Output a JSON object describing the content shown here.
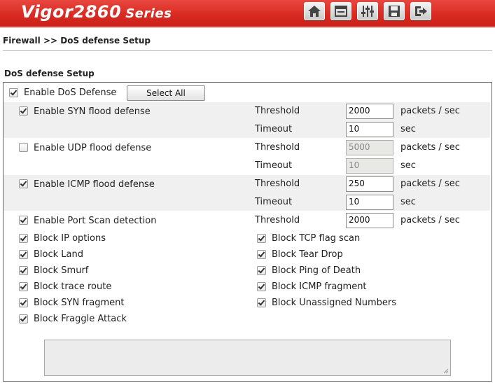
{
  "header": {
    "brand_name": "Vigor2860",
    "brand_series": "Series",
    "icons": [
      "home-icon",
      "quick-start-icon",
      "online-status-icon",
      "save-config-icon",
      "logout-icon"
    ],
    "accent": "#d92b22"
  },
  "breadcrumb": "Firewall >> DoS defense Setup",
  "section_title": "DoS defense Setup",
  "enable_dos": {
    "label": "Enable DoS Defense",
    "checked": true
  },
  "select_all_label": "Select All",
  "flood": [
    {
      "label": "Enable SYN flood defense",
      "checked": true,
      "threshold_label": "Threshold",
      "threshold": "2000",
      "threshold_unit": "packets / sec",
      "timeout_label": "Timeout",
      "timeout": "10",
      "timeout_unit": "sec",
      "disabled": false
    },
    {
      "label": "Enable UDP flood defense",
      "checked": false,
      "threshold_label": "Threshold",
      "threshold": "5000",
      "threshold_unit": "packets / sec",
      "timeout_label": "Timeout",
      "timeout": "10",
      "timeout_unit": "sec",
      "disabled": true
    },
    {
      "label": "Enable ICMP flood defense",
      "checked": true,
      "threshold_label": "Threshold",
      "threshold": "250",
      "threshold_unit": "packets / sec",
      "timeout_label": "Timeout",
      "timeout": "10",
      "timeout_unit": "sec",
      "disabled": false
    }
  ],
  "port_scan": {
    "label": "Enable Port Scan detection",
    "checked": true,
    "threshold_label": "Threshold",
    "threshold": "2000",
    "threshold_unit": "packets / sec"
  },
  "left_options": [
    {
      "label": "Block IP options",
      "checked": true
    },
    {
      "label": "Block Land",
      "checked": true
    },
    {
      "label": "Block Smurf",
      "checked": true
    },
    {
      "label": "Block trace route",
      "checked": true
    },
    {
      "label": "Block SYN fragment",
      "checked": true
    },
    {
      "label": "Block Fraggle Attack",
      "checked": true
    }
  ],
  "right_options": [
    {
      "label": "Block TCP flag scan",
      "checked": true
    },
    {
      "label": "Block Tear Drop",
      "checked": true
    },
    {
      "label": "Block Ping of Death",
      "checked": true
    },
    {
      "label": "Block ICMP fragment",
      "checked": true
    },
    {
      "label": "Block Unassigned Numbers",
      "checked": true
    }
  ]
}
